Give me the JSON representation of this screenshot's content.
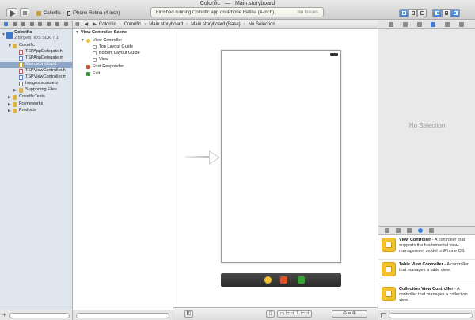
{
  "window": {
    "title_project": "Colorific",
    "title_sep": "—",
    "title_file": "Main.storyboard"
  },
  "toolbar": {
    "scheme": "Colorific",
    "destination": "iPhone Retina (4-inch)",
    "activity_text": "Finished running Colorific.app on iPhone Retina (4-inch)",
    "activity_issues": "No Issues"
  },
  "jumpbar": {
    "crumbs": [
      "Colorific",
      "Colorific",
      "Main.storyboard",
      "Main.storyboard (Base)",
      "No Selection"
    ]
  },
  "navigator": {
    "items": [
      {
        "label": "Colorific"
      },
      {
        "label": "2 targets, iOS SDK 7.1"
      },
      {
        "label": "Colorific"
      },
      {
        "label": "TSPAppDelegate.h"
      },
      {
        "label": "TSPAppDelegate.m"
      },
      {
        "label": "Main.storyboard"
      },
      {
        "label": "TSPViewController.h"
      },
      {
        "label": "TSPViewController.m"
      },
      {
        "label": "Images.xcassets"
      },
      {
        "label": "Supporting Files"
      },
      {
        "label": "ColorificTests"
      },
      {
        "label": "Frameworks"
      },
      {
        "label": "Products"
      }
    ]
  },
  "outline": {
    "items": [
      {
        "label": "View Controller Scene"
      },
      {
        "label": "View Controller"
      },
      {
        "label": "Top Layout Guide"
      },
      {
        "label": "Bottom Layout Guide"
      },
      {
        "label": "View"
      },
      {
        "label": "First Responder"
      },
      {
        "label": "Exit"
      }
    ]
  },
  "inspector": {
    "empty_text": "No Selection"
  },
  "library": {
    "items": [
      {
        "title": "View Controller",
        "desc": " - A controller that supports the fundamental view-management model in iPhone OS."
      },
      {
        "title": "Table View Controller",
        "desc": " - A controller that manages a table view."
      },
      {
        "title": "Collection View Controller",
        "desc": " - A controller that manages a collection view."
      }
    ]
  },
  "canvas_bottom": {
    "zoom_label": "="
  },
  "colors": {
    "selection": "#8fa7c7",
    "accent": "#3d7fd6",
    "object_yellow": "#f2c12e"
  }
}
